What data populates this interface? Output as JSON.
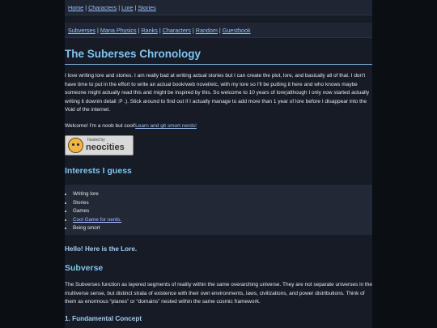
{
  "nav_top": {
    "links": [
      "Home",
      "Characters",
      "Lore",
      "Stories"
    ],
    "separator": "|"
  },
  "nav_sub": {
    "links": [
      "Subverses",
      "Mana Physics",
      "Ranks",
      "Characters",
      "Random",
      "Guestbook"
    ],
    "separator": "|"
  },
  "page_title": "The Suberses Chronology",
  "intro_text": "I love writing lore and stories. I am really bad at writing actual stories but I can create the plot, lore, and basically all of that. I don't have time to put in the effort to write an actual book/web novel/etc, with my lore so I'll be putting it here and who knows maybe someone might actually read this and might be inspired by this. So welcome to 10 years of lore(although I only now started actually writing it downin detail :P .). Stick around to find out if I actually manage to add more than 1 year of lore before I disappear into the Void of the internet.",
  "welcome": {
    "text": "Welcome! I'm a noob but cool!",
    "link": "Learn and git smort nerds!"
  },
  "badge": {
    "small": "hosted by",
    "big": "neocities",
    "icon": "neocities-cat-icon"
  },
  "interests": {
    "heading": "Interests I guess",
    "items": [
      "Writing lore",
      "Stories",
      "Games",
      "Cool Game for nerds.",
      "Being smort"
    ]
  },
  "hello_heading": "Hello! Here is the Lore.",
  "subverse": {
    "heading": "Subverse",
    "text": "The Subverses function as layered segments of reality within the same overarching universe. They are not separate universes in the multiverse sense, but distinct strata of existence with their own environments, laws, civilizations, and power distributions. Think of them as enormous “planes” or “domains” nested within the same cosmic framework."
  },
  "concept_heading": "1. Fundamental Concept",
  "colors": {
    "background": "#0b0e13",
    "content": "#161b25",
    "heading": "#7fc4f2",
    "link": "#9ec3ff"
  }
}
